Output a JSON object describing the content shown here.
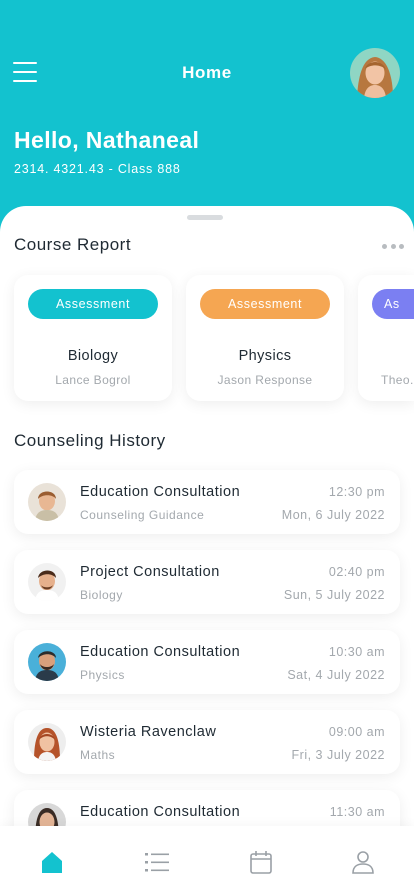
{
  "header": {
    "title": "Home",
    "greeting": "Hello, Nathaneal",
    "subline": "2314. 4321.43 - Class 888"
  },
  "colors": {
    "primary": "#13c2cf",
    "orange": "#f5a652",
    "purple": "#7b7ff2",
    "muted_text": "#a3a8ad"
  },
  "course_report": {
    "title": "Course Report",
    "cards": [
      {
        "badge": "Assessment",
        "course": "Biology",
        "teacher": "Lance Bogrol"
      },
      {
        "badge": "Assessment",
        "course": "Physics",
        "teacher": "Jason Response"
      },
      {
        "badge": "As",
        "course": "",
        "teacher": "Theo."
      }
    ]
  },
  "counseling": {
    "title": "Counseling History",
    "items": [
      {
        "name": "Education Consultation",
        "subject": "Counseling Guidance",
        "time": "12:30 pm",
        "date": "Mon, 6 July 2022"
      },
      {
        "name": "Project Consultation",
        "subject": "Biology",
        "time": "02:40 pm",
        "date": "Sun, 5 July 2022"
      },
      {
        "name": "Education Consultation",
        "subject": "Physics",
        "time": "10:30 am",
        "date": "Sat, 4 July 2022"
      },
      {
        "name": "Wisteria Ravenclaw",
        "subject": "Maths",
        "time": "09:00 am",
        "date": "Fri, 3 July 2022"
      },
      {
        "name": "Education Consultation",
        "subject": "",
        "time": "11:30 am",
        "date": ""
      }
    ]
  },
  "tabbar": {
    "items": [
      {
        "icon": "home-icon",
        "active": true
      },
      {
        "icon": "list-icon",
        "active": false
      },
      {
        "icon": "calendar-icon",
        "active": false
      },
      {
        "icon": "user-icon",
        "active": false
      }
    ]
  }
}
